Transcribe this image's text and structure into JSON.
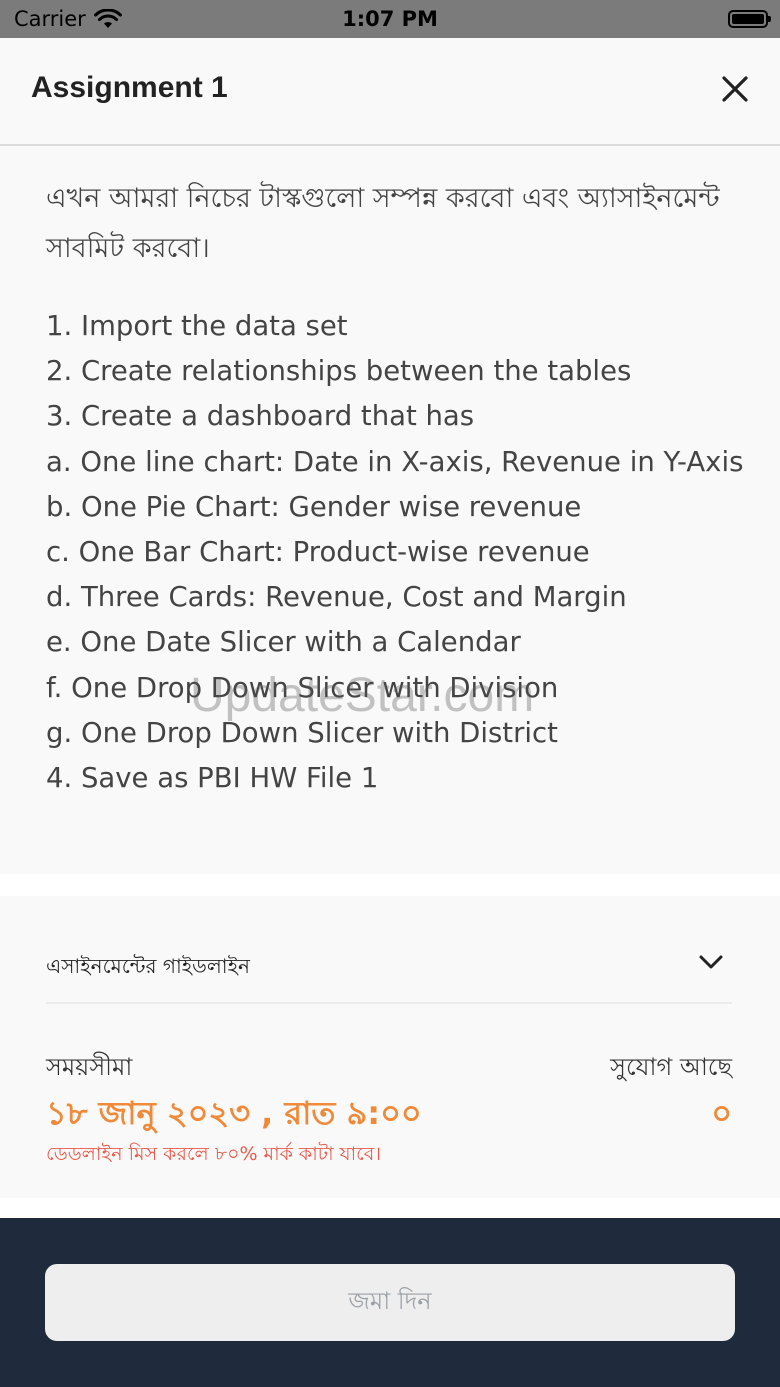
{
  "status_bar": {
    "carrier": "Carrier",
    "time": "1:07 PM"
  },
  "header": {
    "title": "Assignment 1"
  },
  "content": {
    "intro": "এখন আমরা নিচের টাস্কগুলো সম্পন্ন করবো এবং অ্যাসাইনমেন্ট সাবমিট করবো।",
    "tasks": [
      "1. Import the data set",
      "2. Create relationships between the tables",
      "3. Create a dashboard that has",
      "a. One line chart: Date in X-axis, Revenue in Y-Axis",
      "b. One Pie Chart: Gender wise revenue",
      "c. One Bar Chart: Product-wise revenue",
      "d. Three Cards: Revenue, Cost and Margin",
      "e. One Date Slicer with a Calendar",
      "f. One Drop Down Slicer with Division",
      "g. One Drop Down Slicer with District",
      "4. Save as PBI HW File 1"
    ]
  },
  "guideline": {
    "label": "এসাইনমেন্টের গাইডলাইন"
  },
  "deadline": {
    "label": "সময়সীমা",
    "value": "১৮ জানু ২০২৩ , রাত ৯:০০",
    "warning": "ডেডলাইন মিস করলে ৮০% মার্ক কাটা যাবে।"
  },
  "chance": {
    "label": "সুযোগ আছে",
    "value": "০"
  },
  "footer": {
    "submit_label": "জমা দিন"
  },
  "watermark": "UpdateStar.com",
  "colors": {
    "accent": "#f08a3b",
    "warning": "#e85a4b",
    "footer_bg": "#1f2b3c"
  }
}
